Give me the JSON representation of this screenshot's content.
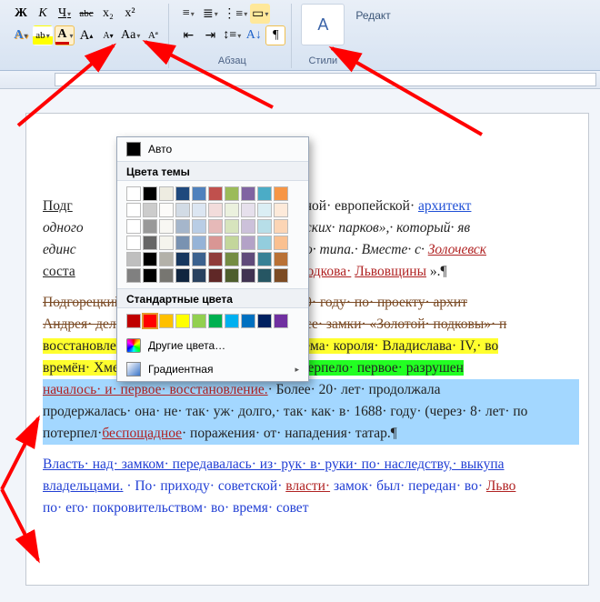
{
  "ribbon": {
    "bold": "Ж",
    "italic": "К",
    "underline": "Ч",
    "strike_label": "abc",
    "subscript": "x₂",
    "superscript": "x²",
    "effects": "A",
    "highlight": "ab",
    "fontcolor": "A",
    "grow": "A",
    "shrink": "A",
    "changecase": "Aa",
    "clear": "Aª",
    "styles_label": "Стили",
    "edit_label": "Редакт",
    "para_label": "Абзац",
    "pilcrow": "¶"
  },
  "panel": {
    "auto": "Авто",
    "theme": "Цвета темы",
    "standard": "Стандартные цвета",
    "other": "Другие цвета…",
    "gradient": "Градиентная",
    "theme_row1": [
      "#ffffff",
      "#000000",
      "#eeece1",
      "#1f497d",
      "#4f81bd",
      "#c0504d",
      "#9bbb59",
      "#8064a2",
      "#4bacc6",
      "#f79646"
    ],
    "standard_row": [
      "#c00000",
      "#ff0000",
      "#ffc000",
      "#ffff00",
      "#92d050",
      "#00b050",
      "#00b0f0",
      "#0070c0",
      "#002060",
      "#7030a0"
    ]
  },
  "doc": {
    "p1": {
      "l1a": "Подг",
      "l1b": "жужиной· европейской· ",
      "l1c": "архитект",
      "l2a": "одного",
      "l2b": "ильянских· парков»,· который· яв",
      "l3a": "единс",
      "l3b": "такого· типа.· Вместе· с· ",
      "l3c": "Золочевск",
      "l4a": "соста",
      "l4b": "отая-подкова·",
      "l4c": "Львовщины",
      "l4d": "».¶"
    },
    "p2": {
      "l1": "Подгорецкий· замок· был· построен· в· 1640· году· по· проекту· архит",
      "l2": "Андрея· дель· Аква.· Этот· замок,· как· и· все· замки· «Золотой· подковы»· п",
      "l3": "восстановлений.· В· 1646· году· после· приёма· короля· Владислава· IV,· во",
      "l4": "времён· Хмельнитчины,",
      "l4b": "· здание· замка· потерпело· первое· разрушен",
      "l5": "началось· и· первое· восстановление.",
      "l5b": "· Более· 20· лет· продолжала",
      "l6": "продержалась· она· не· так· уж· долго,· так· как· в· 1688· году· (через· 8· лет· по",
      "l7": "потерпел·",
      "l7b": "беспощадное",
      "l7c": "· поражения· от· нападения· татар.¶"
    },
    "p3": {
      "l1": "Власть· над· замком· передавалась· из· рук· в· руки· по· наследству,· выкупа",
      "l2a": "владельцами.",
      "l2b": "· По· приходу· советской·",
      "l2c": "власти·",
      "l2d": "замок· был· передан· во·",
      "l2e": "Льво",
      "l3": "по· его· покровительством· во· время· совет"
    }
  }
}
